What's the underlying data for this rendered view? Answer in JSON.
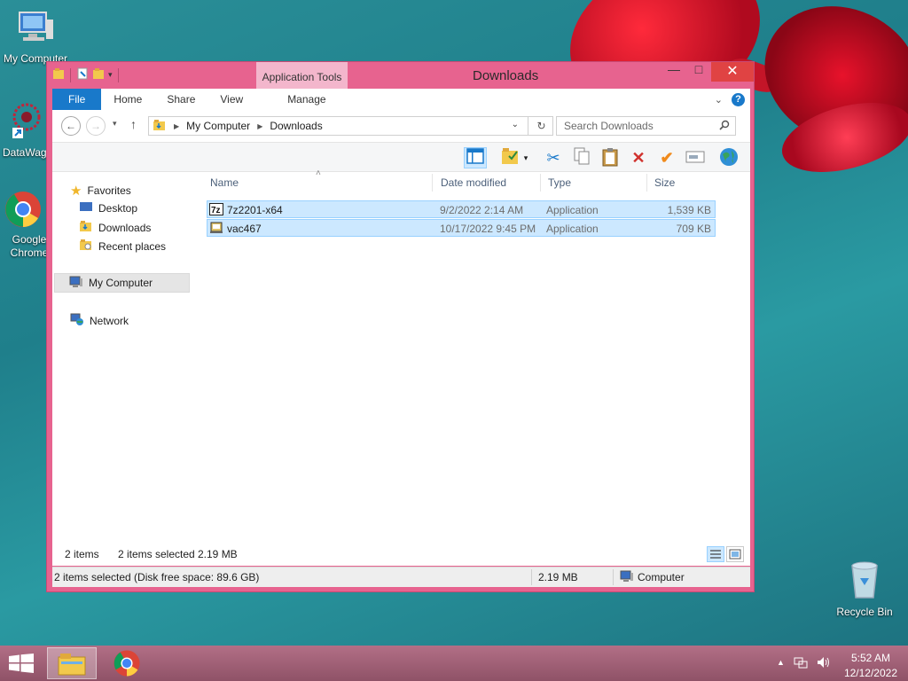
{
  "desktop": {
    "icons": [
      {
        "label": "My Computer"
      },
      {
        "label": "DataWag"
      },
      {
        "label": "Google Chrome"
      },
      {
        "label": "Recycle Bin"
      }
    ]
  },
  "window": {
    "title": "Downloads",
    "contextual_tab_group": "Application Tools",
    "ribbon_tabs": {
      "file": "File",
      "home": "Home",
      "share": "Share",
      "view": "View",
      "manage": "Manage"
    },
    "controls": {
      "minimize": "—",
      "maximize": "□",
      "close": "✕"
    }
  },
  "addressbar": {
    "path": [
      "My Computer",
      "Downloads"
    ],
    "search_placeholder": "Search Downloads"
  },
  "nav_pane": {
    "favorites_label": "Favorites",
    "favorites": [
      "Desktop",
      "Downloads",
      "Recent places"
    ],
    "my_computer": "My Computer",
    "network": "Network"
  },
  "columns": {
    "name": "Name",
    "date": "Date modified",
    "type": "Type",
    "size": "Size"
  },
  "files": [
    {
      "name": "7z2201-x64",
      "date": "9/2/2022 2:14 AM",
      "type": "Application",
      "size": "1,539 KB"
    },
    {
      "name": "vac467",
      "date": "10/17/2022 9:45 PM",
      "type": "Application",
      "size": "709 KB"
    }
  ],
  "status": {
    "item_count": "2 items",
    "selected_count": "2 items selected",
    "selected_size": "2.19 MB",
    "details": "2 items selected (Disk free space: 89.6 GB)",
    "total_size": "2.19 MB",
    "location": "Computer"
  },
  "taskbar": {
    "time": "5:52 AM",
    "date": "12/12/2022"
  },
  "colors": {
    "window_frame": "#e7638f",
    "selection": "#cce8ff",
    "file_tab": "#1979ca",
    "taskbar": "#a3677a"
  }
}
